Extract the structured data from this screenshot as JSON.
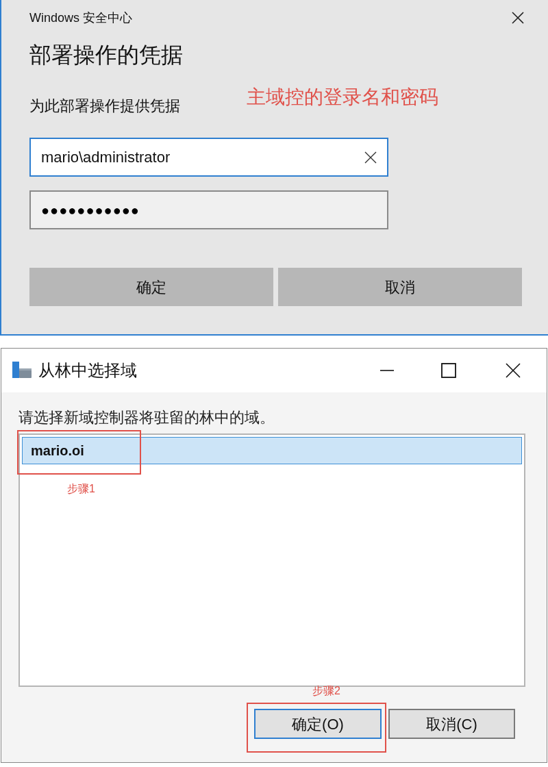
{
  "credential_dialog": {
    "app_title": "Windows 安全中心",
    "heading": "部署操作的凭据",
    "prompt": "为此部署操作提供凭据",
    "username": {
      "value": "mario\\administrator"
    },
    "password": {
      "value": "●●●●●●●●●●●"
    },
    "buttons": [
      {
        "label": "确定"
      },
      {
        "label": "取消"
      }
    ]
  },
  "domain_dialog": {
    "title": "从林中选择域",
    "instruction": "请选择新域控制器将驻留的林中的域。",
    "domains": [
      {
        "label": "mario.oi",
        "selected": true
      }
    ],
    "buttons": [
      {
        "label": "确定(O)",
        "focused": true
      },
      {
        "label": "取消(C)",
        "focused": false
      }
    ]
  },
  "annotations": [
    {
      "kind": "note",
      "text": "主域控的登录名和密码"
    },
    {
      "kind": "step",
      "text": "步骤1"
    },
    {
      "kind": "step",
      "text": "步骤2"
    }
  ]
}
